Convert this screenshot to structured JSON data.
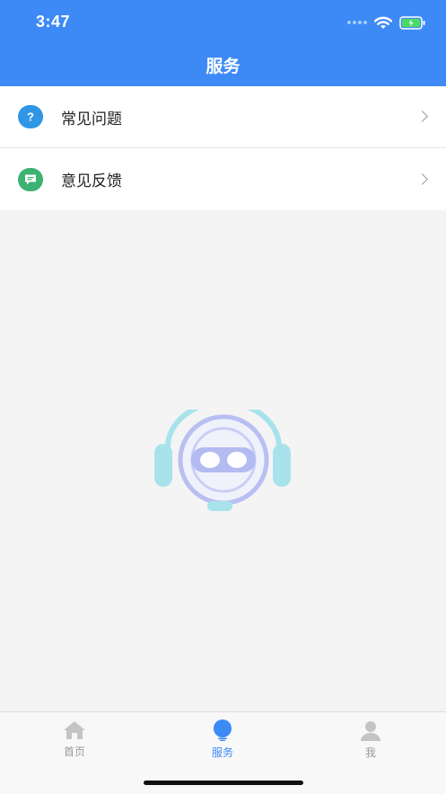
{
  "status_bar": {
    "time": "3:47"
  },
  "header": {
    "title": "服务"
  },
  "menu": [
    {
      "label": "常见问题",
      "icon": "question-icon",
      "icon_color": "#2f96e6"
    },
    {
      "label": "意见反馈",
      "icon": "message-icon",
      "icon_color": "#3cb371"
    }
  ],
  "tabbar": {
    "tabs": [
      {
        "label": "首页",
        "icon": "home-icon",
        "active": false
      },
      {
        "label": "服务",
        "icon": "service-icon",
        "active": true
      },
      {
        "label": "我",
        "icon": "user-icon",
        "active": false
      }
    ]
  },
  "colors": {
    "accent": "#3d8af6",
    "inactive": "#999999"
  }
}
